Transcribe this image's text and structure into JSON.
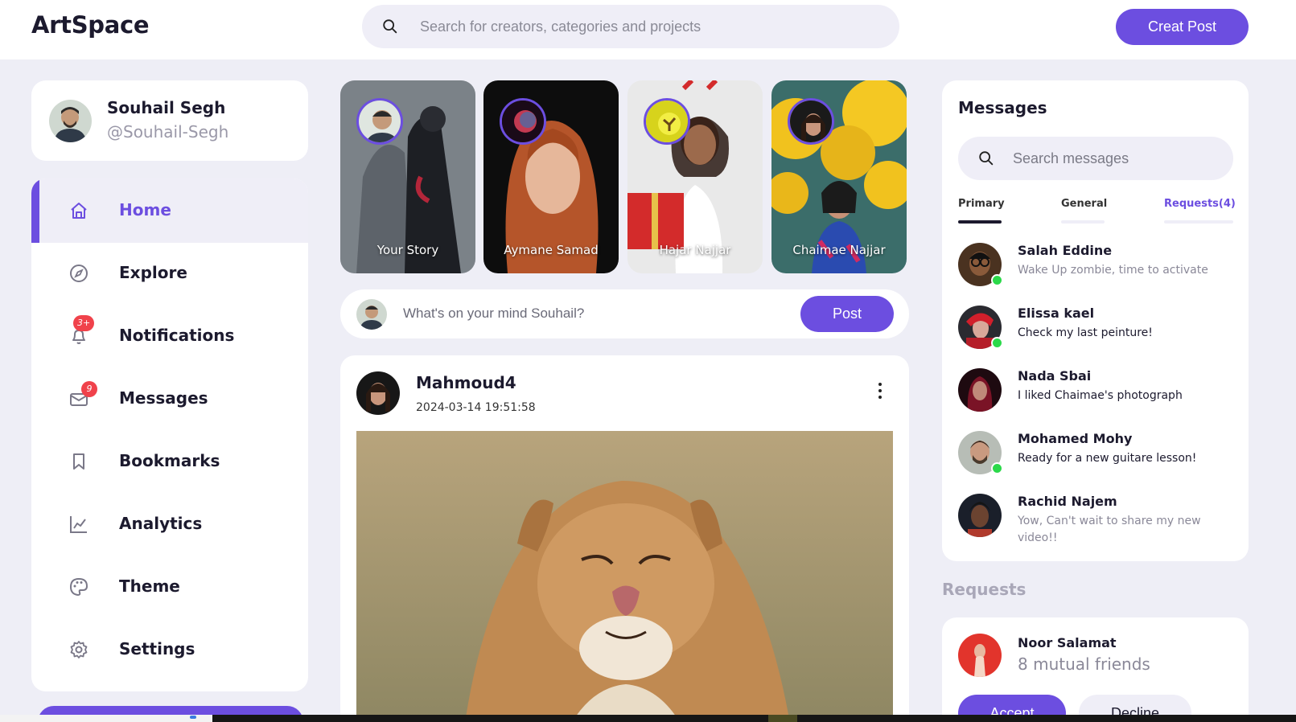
{
  "app": {
    "name": "ArtSpace"
  },
  "header": {
    "search_placeholder": "Search for creators, categories and projects",
    "create_post_label": "Creat Post"
  },
  "profile": {
    "name": "Souhail Segh",
    "handle": "@Souhail-Segh"
  },
  "nav": {
    "items": [
      {
        "label": "Home",
        "icon": "home-icon",
        "active": true
      },
      {
        "label": "Explore",
        "icon": "compass-icon"
      },
      {
        "label": "Notifications",
        "icon": "bell-icon",
        "badge": "3+"
      },
      {
        "label": "Messages",
        "icon": "envelope-icon",
        "badge": "9"
      },
      {
        "label": "Bookmarks",
        "icon": "bookmark-icon"
      },
      {
        "label": "Analytics",
        "icon": "chart-line-icon"
      },
      {
        "label": "Theme",
        "icon": "palette-icon"
      },
      {
        "label": "Settings",
        "icon": "gear-icon"
      }
    ]
  },
  "stories": [
    {
      "label": "Your Story"
    },
    {
      "label": "Aymane Samad"
    },
    {
      "label": "Hajar Najjar"
    },
    {
      "label": "Chaimae Najjar"
    }
  ],
  "composer": {
    "placeholder": "What's on your mind Souhail?",
    "post_label": "Post"
  },
  "feed": {
    "post": {
      "author": "Mahmoud4",
      "timestamp": "2024-03-14 19:51:58"
    }
  },
  "messages": {
    "title": "Messages",
    "search_placeholder": "Search messages",
    "tabs": [
      {
        "label": "Primary",
        "active": true
      },
      {
        "label": "General"
      },
      {
        "label": "Requests(4)"
      }
    ],
    "items": [
      {
        "name": "Salah Eddine",
        "text": "Wake Up zombie, time to activate",
        "online": true,
        "unread": false
      },
      {
        "name": "Elissa kael",
        "text": "Check my last peinture!",
        "online": true,
        "unread": true
      },
      {
        "name": "Nada Sbai",
        "text": "I liked Chaimae's photograph",
        "online": false,
        "unread": true
      },
      {
        "name": "Mohamed Mohy",
        "text": "Ready for a new guitare lesson!",
        "online": true,
        "unread": true
      },
      {
        "name": "Rachid Najem",
        "text": "Yow, Can't wait to share my new video!!",
        "online": false,
        "unread": false
      }
    ]
  },
  "requests": {
    "title": "Requests",
    "item": {
      "name": "Noor Salamat",
      "subtitle": "8 mutual friends",
      "accept_label": "Accept",
      "decline_label": "Decline"
    }
  },
  "colors": {
    "accent": "#6c4ee0",
    "badge": "#f0424b",
    "online": "#2bd94a",
    "background": "#eeeef6"
  }
}
